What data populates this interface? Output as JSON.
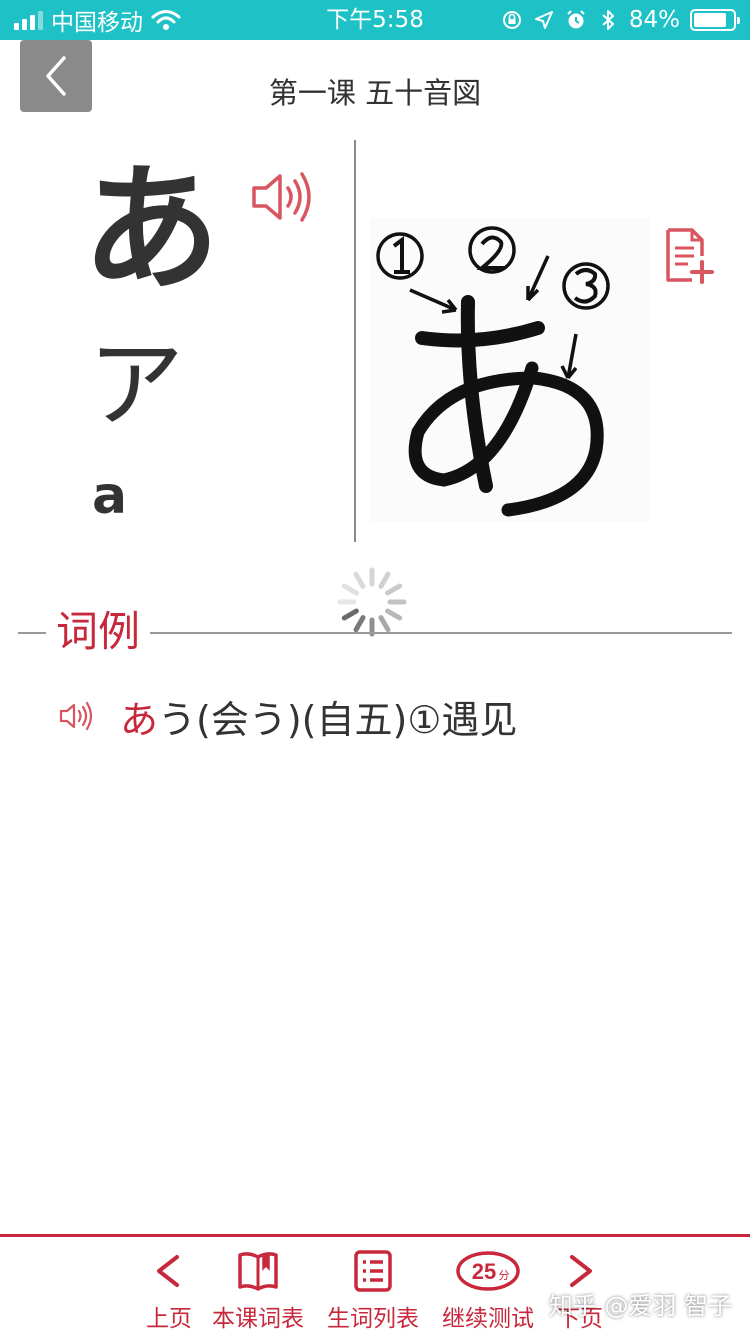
{
  "status_bar": {
    "carrier": "中国移动",
    "time": "下午5:58",
    "battery_percent": "84%",
    "battery_level": 0.84,
    "icons": [
      "signal-icon",
      "wifi-icon",
      "orientation-lock-icon",
      "location-icon",
      "alarm-icon",
      "bluetooth-icon",
      "battery-icon"
    ]
  },
  "header": {
    "title": "第一课  五十音図",
    "back_icon": "chevron-left-icon"
  },
  "kana": {
    "hiragana": "あ",
    "katakana": "ア",
    "romaji": "a"
  },
  "examples": {
    "title": "词例",
    "items": [
      {
        "highlight": "あ",
        "rest": "う(会う)(自五)①遇见"
      }
    ]
  },
  "toolbar": {
    "prev_label": "上页",
    "lesson_words_label": "本课词表",
    "new_words_label": "生词列表",
    "continue_test_label": "继续测试",
    "test_badge": "25",
    "test_badge_unit": "分",
    "next_label": "下页"
  },
  "watermark": "知乎 @爱羽 智子",
  "colors": {
    "status_bar": "#1ec2c6",
    "accent": "#c8283c",
    "text": "#333333",
    "back_button": "#8a8a8a"
  }
}
